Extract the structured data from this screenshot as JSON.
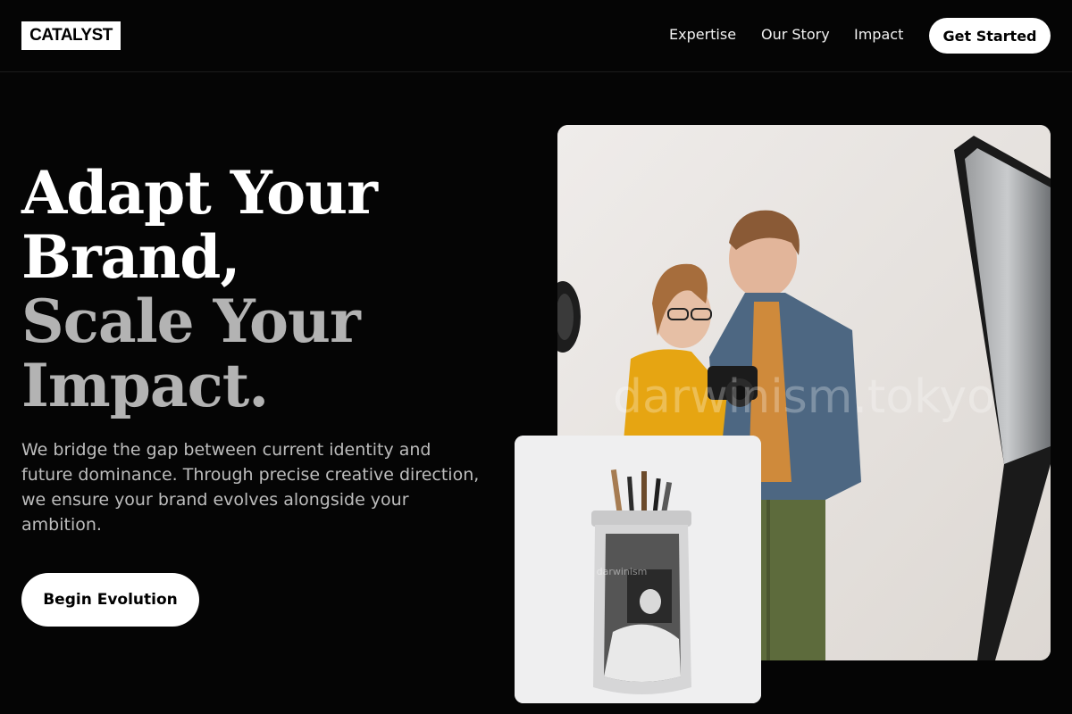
{
  "nav": {
    "logo": "CATALYST",
    "links": [
      "Expertise",
      "Our Story",
      "Impact"
    ],
    "cta": "Get Started"
  },
  "hero": {
    "headline": [
      "Adapt Your",
      "Brand,",
      "Scale Your",
      "Impact."
    ],
    "subtext": "We bridge the gap between current identity and future dominance. Through precise creative direction, we ensure your brand evolves alongside your ambition.",
    "button": "Begin Evolution"
  },
  "images": {
    "main_watermark": "darwinism.tokyo",
    "small_watermark": "darwinism"
  },
  "colors": {
    "background": "#050505",
    "accent_grey": "#b3b3b3",
    "sweater": "#e6a512",
    "jacket": "#4d6782",
    "pants": "#5d6b3c"
  }
}
